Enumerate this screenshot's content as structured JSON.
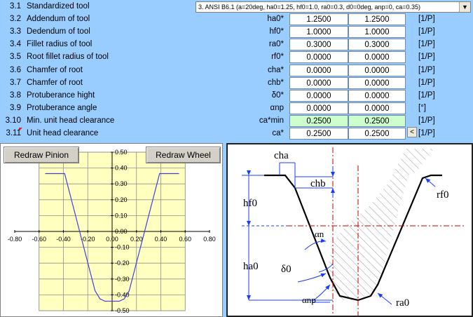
{
  "rows": [
    {
      "num": "3.1",
      "label": "Standardized tool"
    },
    {
      "num": "3.2",
      "label": "Addendum of tool",
      "sym": "ha0*",
      "v1": "1.2500",
      "v2": "1.2500",
      "unit": "[1/P]"
    },
    {
      "num": "3.3",
      "label": "Dedendum of tool",
      "sym": "hf0*",
      "v1": "1.0000",
      "v2": "1.0000",
      "unit": "[1/P]"
    },
    {
      "num": "3.4",
      "label": "Fillet radius of tool",
      "sym": "ra0*",
      "v1": "0.3000",
      "v2": "0.3000",
      "unit": "[1/P]"
    },
    {
      "num": "3.5",
      "label": "Root fillet radius of tool",
      "sym": "rf0*",
      "v1": "0.0000",
      "v2": "0.0000",
      "unit": "[1/P]"
    },
    {
      "num": "3.6",
      "label": "Chamfer of root",
      "sym": "cha*",
      "v1": "0.0000",
      "v2": "0.0000",
      "unit": "[1/P]"
    },
    {
      "num": "3.7",
      "label": "Chamfer of root",
      "sym": "chb*",
      "v1": "0.0000",
      "v2": "0.0000",
      "unit": "[1/P]"
    },
    {
      "num": "3.8",
      "label": "Protuberance hight",
      "sym": "δ0*",
      "v1": "0.0000",
      "v2": "0.0000",
      "unit": "[1/P]"
    },
    {
      "num": "3.9",
      "label": "Protuberance angle",
      "sym": "αnp",
      "v1": "0.0000",
      "v2": "0.0000",
      "unit": "[°]"
    },
    {
      "num": "3.10",
      "label": "Min. unit head clearance",
      "sym": "ca*min",
      "v1": "0.2500",
      "v2": "0.2500",
      "unit": "[1/P]"
    },
    {
      "num": "3.11",
      "label": "Unit head clearance",
      "sym": "ca*",
      "v1": "0.2500",
      "v2": "0.2500",
      "unit": "[1/P]"
    }
  ],
  "dropdown": {
    "value": "3. ANSI B6.1 (a=20deg, ha0=1.25, hf0=1.0, ra0=0.3, d0=0deg, anp=0, ca=0.35)",
    "arrow": "▼"
  },
  "collapse_label": "<",
  "buttons": {
    "pinion": "Redraw Pinion",
    "wheel": "Redraw Wheel"
  },
  "colors": {
    "background": "#99ccff",
    "plot_area": "#ffffc0",
    "line": "#4040e0",
    "result_cell": "#ccffcc",
    "dim_blue": "#1a3cff",
    "center_red": "#cc0000"
  },
  "chart_data": {
    "type": "line",
    "xlim": [
      -0.8,
      0.8
    ],
    "ylim": [
      -0.5,
      0.5
    ],
    "x_ticks": [
      "-0.80",
      "-0.60",
      "-0.40",
      "-0.20",
      "0.00",
      "0.20",
      "0.40",
      "0.60",
      "0.80"
    ],
    "y_ticks": [
      "0.50",
      "0.40",
      "0.30",
      "0.20",
      "0.10",
      "0.00",
      "-0.10",
      "-0.20",
      "-0.30",
      "-0.40",
      "-0.50"
    ],
    "grid": true,
    "legend": "none",
    "series": [
      {
        "x": [
          -0.55,
          -0.39,
          -0.14,
          -0.1,
          -0.06,
          0.06,
          0.1,
          0.14,
          0.39,
          0.55
        ],
        "y": [
          0.365,
          0.365,
          -0.375,
          -0.425,
          -0.44,
          -0.44,
          -0.425,
          -0.375,
          0.365,
          0.365
        ]
      }
    ]
  },
  "diagram_labels": {
    "cha": "cha",
    "chb": "chb",
    "hf0": "hf0",
    "ha0": "ha0",
    "rf0": "rf0",
    "ra0": "ra0",
    "delta0": "δ0",
    "alpha_n": "αn",
    "alpha_np": "αnp"
  }
}
